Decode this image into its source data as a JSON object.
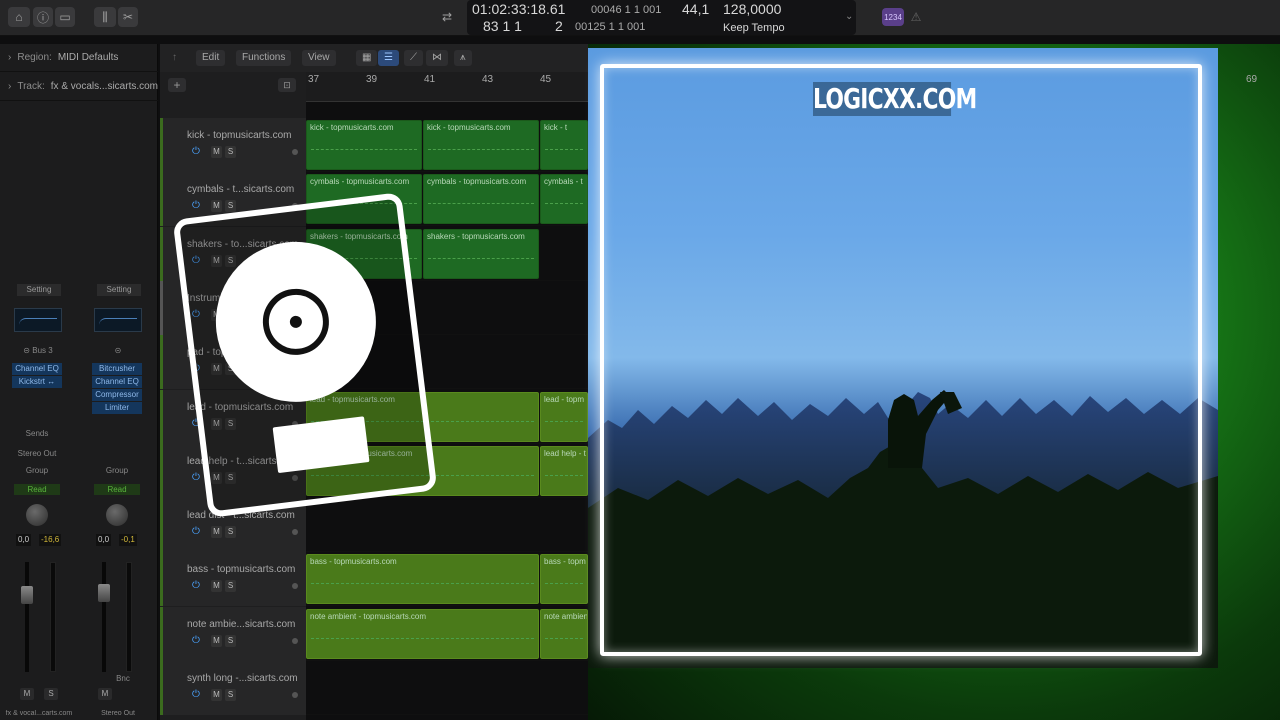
{
  "transport": {
    "time": "01:02:33:18.61",
    "bars": "00046  1  1  001",
    "position": "83 1 1",
    "beats": "2",
    "tempo_bars": "00125  1  1  001",
    "sample_rate": "44,1",
    "tempo": "128,0000",
    "tempo_mode": "Keep Tempo",
    "count_in": "1234"
  },
  "inspector": {
    "region_label": "Region:",
    "region_value": "MIDI Defaults",
    "track_label": "Track:",
    "track_value": "fx & vocals...sicarts.com",
    "strip1": {
      "setting": "Setting",
      "bus": "Bus 3",
      "plugins": [
        "Channel EQ",
        "Kickstrt ↔"
      ],
      "sends": "Sends",
      "output": "Stereo Out",
      "group": "Group",
      "automation": "Read",
      "pan": "0,0",
      "level": "-16,6",
      "mute": "M",
      "solo": "S",
      "name": "fx & vocal...carts.com"
    },
    "strip2": {
      "setting": "Setting",
      "plugins": [
        "Bitcrusher",
        "Channel EQ",
        "Compressor",
        "Limiter"
      ],
      "group": "Group",
      "automation": "Read",
      "pan": "0,0",
      "level": "-0,1",
      "bnc": "Bnc",
      "mute": "M",
      "name": "Stereo Out"
    }
  },
  "editor_toolbar": {
    "edit": "Edit",
    "functions": "Functions",
    "view": "View"
  },
  "ruler": [
    "37",
    "39",
    "41",
    "43",
    "45",
    "69"
  ],
  "tracks": [
    {
      "name": "kick - topmusicarts.com",
      "regions": [
        "kick - topmusicarts.com",
        "kick - topmusicarts.com",
        "kick - t"
      ]
    },
    {
      "name": "cymbals - t...sicarts.com",
      "regions": [
        "cymbals - topmusicarts.com",
        "cymbals - topmusicarts.com",
        "cymbals - t"
      ]
    },
    {
      "name": "shakers - to...sicarts.com",
      "regions": [
        "shakers - topmusicarts.com",
        "shakers - topmusicarts.com"
      ]
    },
    {
      "name": "Instruments",
      "regions": []
    },
    {
      "name": "pad - topmusicarts.com",
      "regions": []
    },
    {
      "name": "lead - topmusicarts.com",
      "regions": [
        "lead - topmusicarts.com",
        "lead - topm"
      ]
    },
    {
      "name": "lead help - t...sicarts.com",
      "regions": [
        "lead help - topmusicarts.com",
        "lead help - t"
      ]
    },
    {
      "name": "lead dist - t...sicarts.com",
      "regions": []
    },
    {
      "name": "bass - topmusicarts.com",
      "regions": [
        "bass - topmusicarts.com",
        "bass - topm"
      ]
    },
    {
      "name": "note ambie...sicarts.com",
      "regions": [
        "note ambient - topmusicarts.com",
        "note ambien"
      ]
    },
    {
      "name": "synth long -...sicarts.com",
      "regions": []
    }
  ],
  "track_controls": {
    "mute": "M",
    "solo": "S"
  },
  "cover": {
    "watermark": "LOGICXX.COM"
  },
  "colors": {
    "region_green": "#1e6a23",
    "region_lime": "#4a7a1a",
    "frame": "#ffffff",
    "accent_blue": "#4aa3ff"
  }
}
